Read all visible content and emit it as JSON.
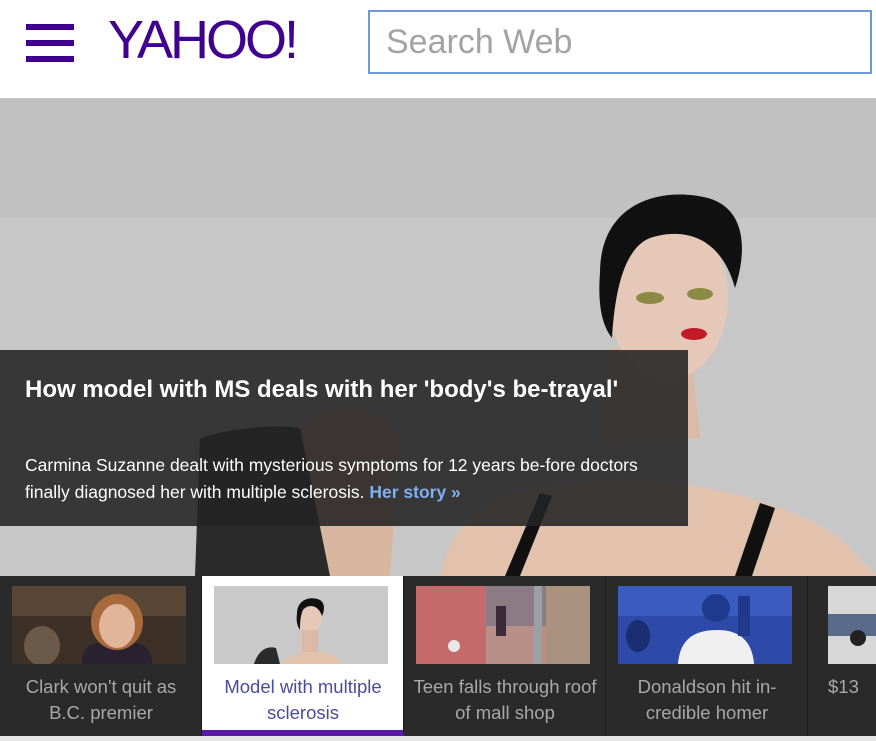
{
  "header": {
    "logo": "YAHOO!",
    "search_placeholder": "Search Web"
  },
  "hero": {
    "title": "How model with MS deals with her 'body's be-trayal'",
    "description": "Carmina Suzanne dealt with mysterious symptoms for 12 years be-fore doctors finally diagnosed her with multiple sclerosis.",
    "link": "Her story »"
  },
  "carousel": {
    "items": [
      {
        "label": "Clark won't quit as B.C. premier"
      },
      {
        "label": "Model with multiple sclerosis",
        "active": true
      },
      {
        "label": "Teen falls through roof of mall shop"
      },
      {
        "label": "Donaldson hit in-credible homer"
      },
      {
        "label": "$13"
      }
    ]
  },
  "colors": {
    "brand": "#400090",
    "active_underline": "#5a1aa6",
    "link": "#7fb0f0",
    "search_border": "#6b9ad6"
  }
}
